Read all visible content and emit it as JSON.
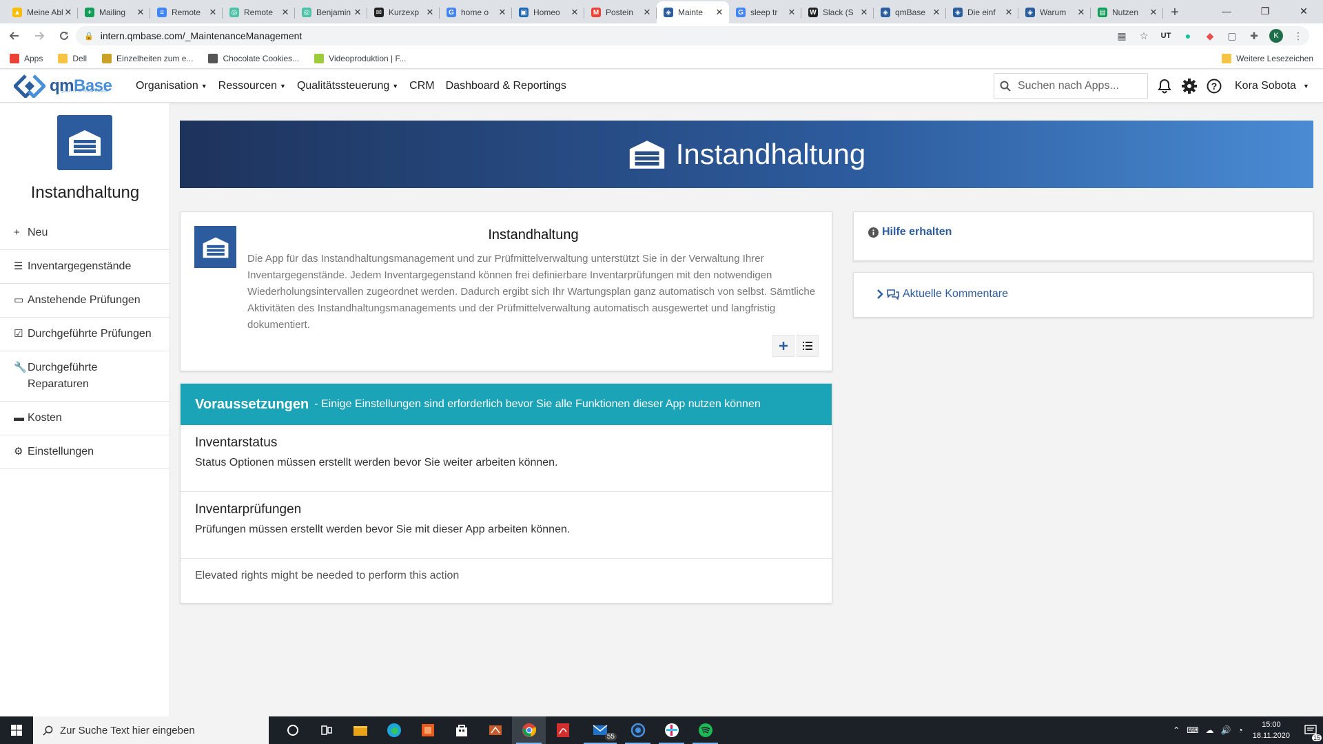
{
  "browser": {
    "tabs": [
      {
        "title": "Meine Ablage",
        "color": "#fbbc04",
        "glyph": "▲"
      },
      {
        "title": "Mailing",
        "color": "#0f9d58",
        "glyph": "+"
      },
      {
        "title": "Remote",
        "color": "#4285f4",
        "glyph": "≡"
      },
      {
        "title": "Remote",
        "color": "#4ec2a8",
        "glyph": "◎"
      },
      {
        "title": "Benjamin",
        "color": "#4ec2a8",
        "glyph": "◎"
      },
      {
        "title": "Kurzexp",
        "color": "#222222",
        "glyph": "✉"
      },
      {
        "title": "home o",
        "color": "#4285f4",
        "glyph": "G"
      },
      {
        "title": "Homeo",
        "color": "#1f6ab3",
        "glyph": "▣"
      },
      {
        "title": "Postein",
        "color": "#ea4335",
        "glyph": "M"
      },
      {
        "title": "Mainte",
        "color": "#2c5d9d",
        "glyph": "◈",
        "active": true
      },
      {
        "title": "sleep tr",
        "color": "#4285f4",
        "glyph": "G"
      },
      {
        "title": "Slack (S",
        "color": "#222222",
        "glyph": "W"
      },
      {
        "title": "qmBase",
        "color": "#2c5d9d",
        "glyph": "◈"
      },
      {
        "title": "Die einf",
        "color": "#2c5d9d",
        "glyph": "◈"
      },
      {
        "title": "Warum",
        "color": "#2c5d9d",
        "glyph": "◈"
      },
      {
        "title": "Nutzen",
        "color": "#0f9d58",
        "glyph": "▤"
      }
    ],
    "url": "intern.qmbase.com/_MaintenanceManagement",
    "bookmarks": [
      {
        "label": "Apps",
        "color": "#ea4335"
      },
      {
        "label": "Dell",
        "color": "#f6c344"
      },
      {
        "label": "Einzelheiten zum e...",
        "color": "#c9a227"
      },
      {
        "label": "Chocolate Cookies...",
        "color": "#555555"
      },
      {
        "label": "Videoproduktion | F...",
        "color": "#9ccc3a"
      }
    ],
    "bookmarks_right": "Weitere Lesezeichen",
    "profile_initial": "K"
  },
  "header": {
    "logo_main": "qm",
    "logo_accent": "Base",
    "logo_tagline": "QUALITY IN YOUR HANDS",
    "nav": [
      {
        "label": "Organisation",
        "dropdown": true
      },
      {
        "label": "Ressourcen",
        "dropdown": true
      },
      {
        "label": "Qualitätssteuerung",
        "dropdown": true
      },
      {
        "label": "CRM",
        "dropdown": false
      },
      {
        "label": "Dashboard & Reportings",
        "dropdown": false
      }
    ],
    "search_placeholder": "Suchen nach Apps...",
    "user_name": "Kora Sobota"
  },
  "sidebar": {
    "title": "Instandhaltung",
    "items": [
      {
        "label": "Neu",
        "icon": "plus-icon",
        "glyph": "+"
      },
      {
        "label": "Inventargegenstände",
        "icon": "list-icon",
        "glyph": "☰"
      },
      {
        "label": "Anstehende Prüfungen",
        "icon": "calendar-icon",
        "glyph": "▭"
      },
      {
        "label": "Durchgeführte Prüfungen",
        "icon": "check-square-icon",
        "glyph": "☑"
      },
      {
        "label": "Durchgeführte Reparaturen",
        "icon": "wrench-icon",
        "glyph": "🔧"
      },
      {
        "label": "Kosten",
        "icon": "money-icon",
        "glyph": "▬"
      },
      {
        "label": "Einstellungen",
        "icon": "gear-icon",
        "glyph": "⚙"
      }
    ]
  },
  "banner": {
    "title": "Instandhaltung"
  },
  "info_card": {
    "title": "Instandhaltung",
    "description": "Die App für das Instandhaltungsmanagement und zur Prüfmittelverwaltung unterstützt Sie in der Verwaltung Ihrer Inventargegenstände. Jedem Inventargegenstand können frei definierbare Inventarprüfungen mit den notwendigen Wiederholungsintervallen zugeordnet werden. Dadurch ergibt sich Ihr Wartungsplan ganz automatisch von selbst. Sämtliche Aktivitäten des Instandhaltungsmanagements und der Prüfmittelverwaltung automatisch ausgewertet und langfristig dokumentiert."
  },
  "prerequisites": {
    "title": "Voraussetzungen",
    "subtitle": "- Einige Einstellungen sind erforderlich bevor Sie alle Funktionen dieser App nutzen können",
    "sections": [
      {
        "title": "Inventarstatus",
        "text": "Status Optionen müssen erstellt werden bevor Sie weiter arbeiten können."
      },
      {
        "title": "Inventarprüfungen",
        "text": "Prüfungen müssen erstellt werden bevor Sie mit dieser App arbeiten können."
      }
    ],
    "note": "Elevated rights might be needed to perform this action"
  },
  "help": {
    "label": "Hilfe erhalten"
  },
  "comments": {
    "label": "Aktuelle Kommentare"
  },
  "taskbar": {
    "search_placeholder": "Zur Suche Text hier eingeben",
    "mail_badge": "55",
    "time": "15:00",
    "date": "18.11.2020",
    "notification_count": "15"
  },
  "colors": {
    "brand": "#2d5c9e",
    "teal": "#1ba3b7"
  }
}
